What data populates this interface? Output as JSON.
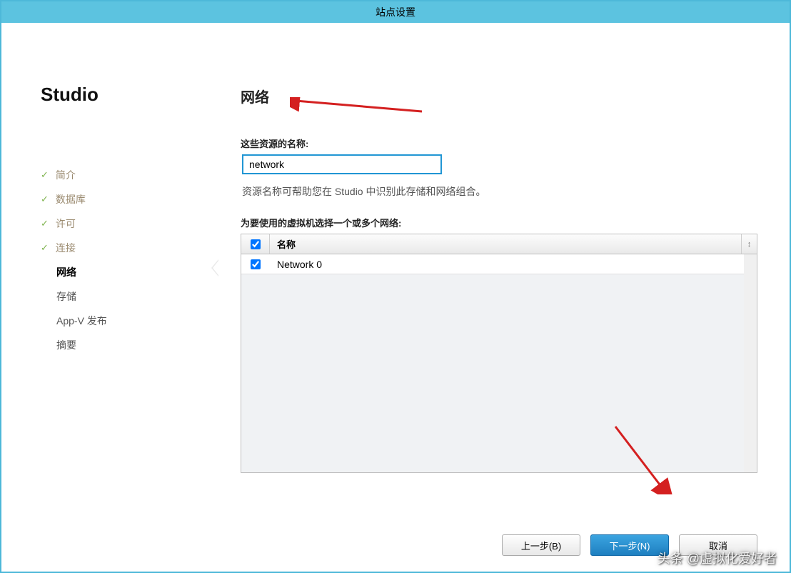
{
  "window": {
    "title": "站点设置"
  },
  "sidebar": {
    "brand": "Studio",
    "items": [
      {
        "label": "简介",
        "state": "completed"
      },
      {
        "label": "数据库",
        "state": "completed"
      },
      {
        "label": "许可",
        "state": "completed"
      },
      {
        "label": "连接",
        "state": "completed"
      },
      {
        "label": "网络",
        "state": "current"
      },
      {
        "label": "存储",
        "state": "pending"
      },
      {
        "label": "App-V 发布",
        "state": "pending"
      },
      {
        "label": "摘要",
        "state": "pending"
      }
    ]
  },
  "main": {
    "heading": "网络",
    "name_label": "这些资源的名称:",
    "name_value": "network",
    "helper_text": "资源名称可帮助您在 Studio 中识别此存储和网络组合。",
    "network_label": "为要使用的虚拟机选择一个或多个网络:",
    "table": {
      "header_name": "名称",
      "rows": [
        {
          "checked": true,
          "name": "Network 0"
        }
      ]
    }
  },
  "buttons": {
    "back": "上一步(B)",
    "next": "下一步(N)",
    "cancel": "取消"
  },
  "watermark": "头条 @虚拟化爱好者"
}
